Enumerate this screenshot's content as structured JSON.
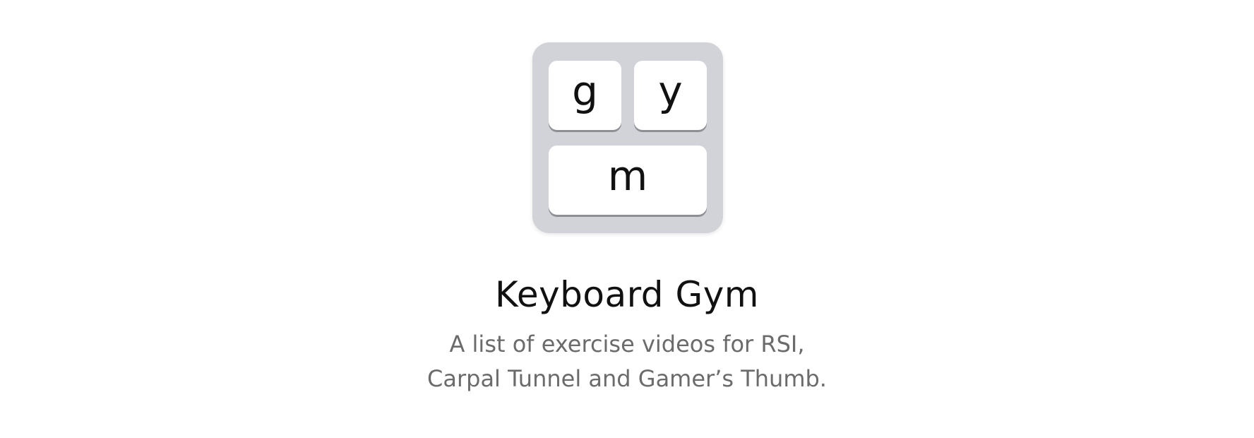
{
  "app_icon": {
    "keys": {
      "g": "g",
      "y": "y",
      "m": "m"
    },
    "colors": {
      "frame": "#d1d3d9",
      "key": "#ffffff",
      "key_shadow": "#8e8f93"
    }
  },
  "title": "Keyboard Gym",
  "subtitle": {
    "line1": "A list of exercise videos for RSI,",
    "line2": "Carpal Tunnel and Gamer’s Thumb."
  }
}
